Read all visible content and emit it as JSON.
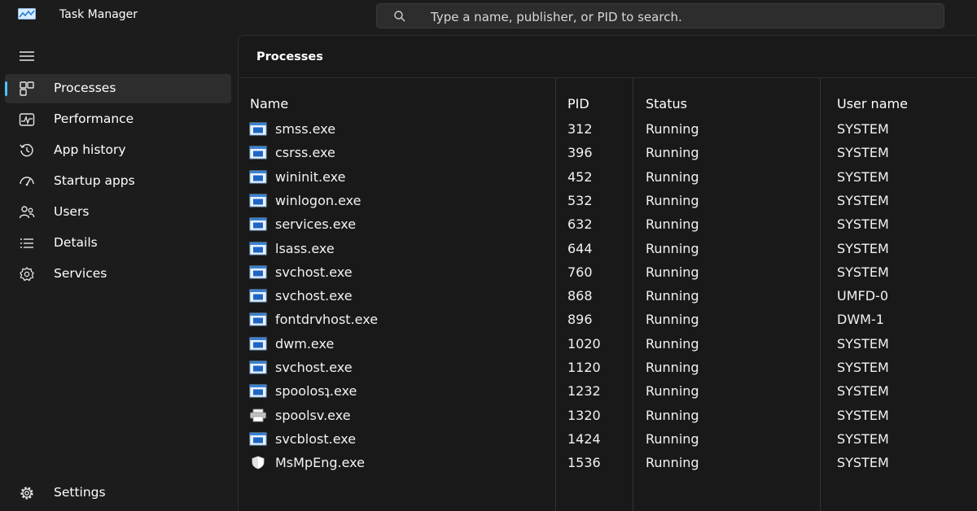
{
  "app": {
    "title": "Task Manager",
    "icon": "task-manager-icon"
  },
  "search": {
    "placeholder": "Type a name, publisher, or PID to search.",
    "icon": "search-icon"
  },
  "sidebar": {
    "menu_icon": "hamburger-menu-icon",
    "items": [
      {
        "label": "Processes",
        "icon": "processes-icon",
        "active": true
      },
      {
        "label": "Performance",
        "icon": "performance-icon",
        "active": false
      },
      {
        "label": "App history",
        "icon": "app-history-icon",
        "active": false
      },
      {
        "label": "Startup apps",
        "icon": "startup-apps-icon",
        "active": false
      },
      {
        "label": "Users",
        "icon": "users-icon",
        "active": false
      },
      {
        "label": "Details",
        "icon": "details-icon",
        "active": false
      },
      {
        "label": "Services",
        "icon": "services-icon",
        "active": false
      }
    ],
    "settings": {
      "label": "Settings",
      "icon": "settings-icon"
    }
  },
  "main": {
    "title": "Processes",
    "columns": [
      "Name",
      "PID",
      "Status",
      "User name"
    ],
    "rows": [
      {
        "name": "smss.exe",
        "pid": "312",
        "status": "Running",
        "user": "SYSTEM",
        "icon": "window-app-icon"
      },
      {
        "name": "csrss.exe",
        "pid": "396",
        "status": "Running",
        "user": "SYSTEM",
        "icon": "window-app-icon"
      },
      {
        "name": "wininit.exe",
        "pid": "452",
        "status": "Running",
        "user": "SYSTEM",
        "icon": "window-app-icon"
      },
      {
        "name": "winlogon.exe",
        "pid": "532",
        "status": "Running",
        "user": "SYSTEM",
        "icon": "window-app-icon"
      },
      {
        "name": "services.exe",
        "pid": "632",
        "status": "Running",
        "user": "SYSTEM",
        "icon": "window-app-icon"
      },
      {
        "name": "lsass.exe",
        "pid": "644",
        "status": "Running",
        "user": "SYSTEM",
        "icon": "window-app-icon"
      },
      {
        "name": "svchost.exe",
        "pid": "760",
        "status": "Running",
        "user": "SYSTEM",
        "icon": "window-app-icon"
      },
      {
        "name": "svchost.exe",
        "pid": "868",
        "status": "Running",
        "user": "UMFD-0",
        "icon": "window-app-icon"
      },
      {
        "name": "fontdrvhost.exe",
        "pid": "896",
        "status": "Running",
        "user": "DWM-1",
        "icon": "window-app-icon"
      },
      {
        "name": "dwm.exe",
        "pid": "1020",
        "status": "Running",
        "user": "SYSTEM",
        "icon": "window-app-icon"
      },
      {
        "name": "svchost.exe",
        "pid": "1120",
        "status": "Running",
        "user": "SYSTEM",
        "icon": "window-app-icon"
      },
      {
        "name": "spoolosʇ.exe",
        "pid": "1232",
        "status": "Running",
        "user": "SYSTEM",
        "icon": "window-app-icon"
      },
      {
        "name": "spoolsv.exe",
        "pid": "1320",
        "status": "Running",
        "user": "SYSTEM",
        "icon": "printer-icon"
      },
      {
        "name": "svcblost.exe",
        "pid": "1424",
        "status": "Running",
        "user": "SYSTEM",
        "icon": "window-app-icon"
      },
      {
        "name": "MsMpEng.exe",
        "pid": "1536",
        "status": "Running",
        "user": "SYSTEM",
        "icon": "shield-icon"
      }
    ]
  },
  "colors": {
    "background": "#1c1c1c",
    "panel": "#191919",
    "accent": "#4cc2ff",
    "text": "#ffffff"
  }
}
